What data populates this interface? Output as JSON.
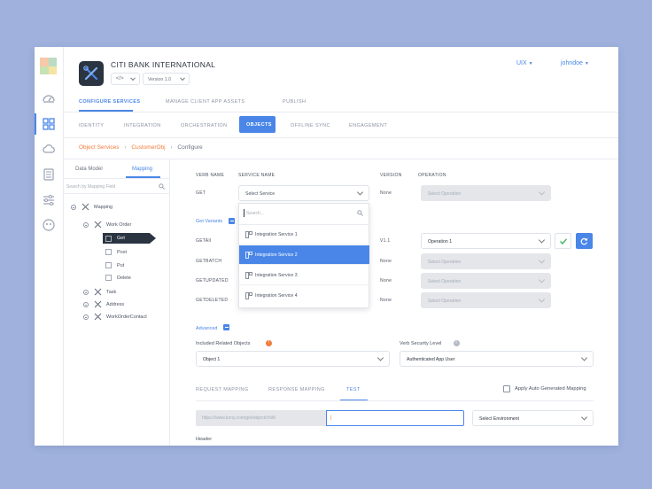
{
  "header": {
    "app_title": "CITI BANK INTERNATIONAL",
    "code_select": "</>",
    "version_select": "Version 1.0",
    "env": "UIX",
    "user": "johndoe"
  },
  "main_tabs": [
    "CONFIGURE SERVICES",
    "MANAGE CLIENT APP ASSETS",
    "PUBLISH"
  ],
  "sub_tabs": [
    "IDENTITY",
    "INTEGRATION",
    "ORCHESTRATION",
    "OBJECTS",
    "OFFLINE SYNC",
    "ENGAGEMENT"
  ],
  "breadcrumb": [
    "Object Services",
    "CustomerObj",
    "Configure"
  ],
  "left_panel": {
    "tabs": [
      "Data Model",
      "Mapping"
    ],
    "search_placeholder": "Search by Mapping Field",
    "tree": {
      "root": "Mapping",
      "work_order": "Work Order",
      "methods": [
        "Get",
        "Post",
        "Put",
        "Delete"
      ],
      "others": [
        "Task",
        "Address",
        "WorkOrderContact"
      ]
    }
  },
  "form": {
    "col_verb": "VERB NAME",
    "col_service": "SERVICE NAME",
    "col_version": "VERSION",
    "col_operation": "OPERATION",
    "get_verb": "GET",
    "service_select": "Select Service",
    "none": "None",
    "select_operation": "Select Operation",
    "get_variants": "Get Variants",
    "variants": [
      {
        "verb": "GETAll",
        "version": "V1.1",
        "operation": "Operation 1"
      },
      {
        "verb": "GETBATCH",
        "version": "None",
        "operation": "Select Operation"
      },
      {
        "verb": "GETUPDATED",
        "version": "None",
        "operation": "Select Operation"
      },
      {
        "verb": "GETDELETED",
        "version": "None",
        "operation": "Select Operation"
      }
    ],
    "advanced": "Advanced",
    "related_label": "Included Related Objects",
    "related_value": "Object 1",
    "security_label": "Verb Security Level",
    "security_value": "Authenticated App User",
    "mapping_tabs": [
      "REQUEST MAPPING",
      "RESPONSE MAPPING",
      "TEST"
    ],
    "auto_mapping": "Apply Auto Generated Mapping",
    "url": "https://www.kony.com/get/object/child",
    "url_input": "|",
    "env_select": "Select Environment",
    "header_label": "Header"
  },
  "dropdown": {
    "search_placeholder": "Search...",
    "items": [
      "Integration Service 1",
      "Integration Service 2",
      "Integration Service 3",
      "Integration Service 4"
    ],
    "selected_index": 1
  },
  "colors": {
    "accent": "#4a86e8",
    "orange": "#f07c3a",
    "background": "#9fb1dc"
  }
}
